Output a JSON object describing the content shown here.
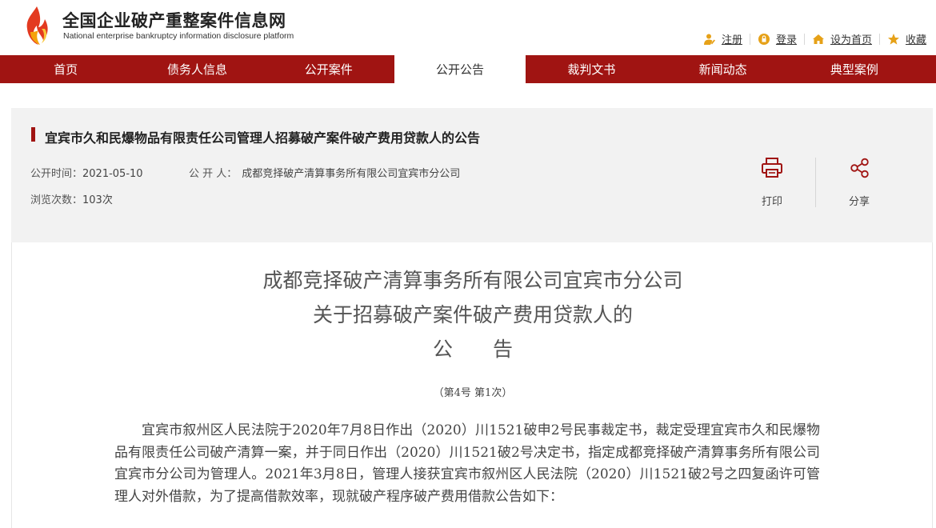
{
  "header": {
    "site_title": "全国企业破产重整案件信息网",
    "site_subtitle": "National enterprise bankruptcy  information disclosure platform",
    "top_links": {
      "register": "注册",
      "login": "登录",
      "set_homepage": "设为首页",
      "favorite": "收藏"
    }
  },
  "nav": {
    "items": [
      "首页",
      "债务人信息",
      "公开案件",
      "公开公告",
      "裁判文书",
      "新闻动态",
      "典型案例"
    ],
    "active": "公开公告"
  },
  "notice": {
    "title": "宜宾市久和民爆物品有限责任公司管理人招募破产案件破产费用贷款人的公告",
    "publish_time_label": "公开时间：",
    "publish_time": "2021-05-10",
    "publisher_label": "公 开 人：",
    "publisher": "成都竞择破产清算事务所有限公司宜宾市分公司",
    "views_label": "浏览次数：",
    "views": "103次",
    "print_label": "打印",
    "share_label": "分享"
  },
  "document": {
    "title_line1": "成都竞择破产清算事务所有限公司宜宾市分公司",
    "title_line2": "关于招募破产案件破产费用贷款人的",
    "title_line3": "公　　告",
    "number": "（第4号 第1次）",
    "body": "宜宾市叙州区人民法院于2020年7月8日作出（2020）川1521破申2号民事裁定书，裁定受理宜宾市久和民爆物品有限责任公司破产清算一案，并于同日作出（2020）川1521破2号决定书，指定成都竞择破产清算事务所有限公司宜宾市分公司为管理人。2021年3月8日，管理人接获宜宾市叙州区人民法院（2020）川1521破2号之四复函许可管理人对外借款，为了提高借款效率，现就破产程序破产费用借款公告如下："
  },
  "colors": {
    "brand_red": "#a01412",
    "panel_bg": "#f2f2f2",
    "icon_orange": "#e6a118"
  }
}
